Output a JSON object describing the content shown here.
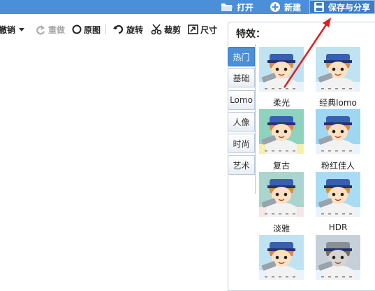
{
  "topbar": {
    "open_label": "打开",
    "new_label": "新建",
    "save_share_label": "保存与分享"
  },
  "toolbar": {
    "undo_label": "撤销",
    "redo_label": "重做",
    "original_label": "原图",
    "rotate_label": "旋转",
    "crop_label": "裁剪",
    "size_label": "尺寸"
  },
  "effects_panel": {
    "title": "特效：",
    "tabs": [
      "热门",
      "基础",
      "Lomo",
      "人像",
      "时尚",
      "艺术"
    ],
    "active_tab": "热门",
    "effects": [
      {
        "label": "",
        "bg": "#bfe3f3",
        "tint": "none"
      },
      {
        "label": "",
        "bg": "#bfe3f3",
        "tint": "none"
      },
      {
        "label": "柔光",
        "bg": "#8fd3bf",
        "tint": "warm"
      },
      {
        "label": "经典lomo",
        "bg": "#9fd6f2",
        "tint": "none"
      },
      {
        "label": "复古",
        "bg": "#a9d5ce",
        "tint": "retro"
      },
      {
        "label": "粉红佳人",
        "bg": "#a8dcf5",
        "tint": "none"
      },
      {
        "label": "淡雅",
        "bg": "#bfe3f3",
        "tint": "none"
      },
      {
        "label": "HDR",
        "bg": "#c6d0d8",
        "tint": "gray"
      }
    ]
  },
  "colors": {
    "accent": "#4a8fd8",
    "arrow": "#e02020"
  }
}
